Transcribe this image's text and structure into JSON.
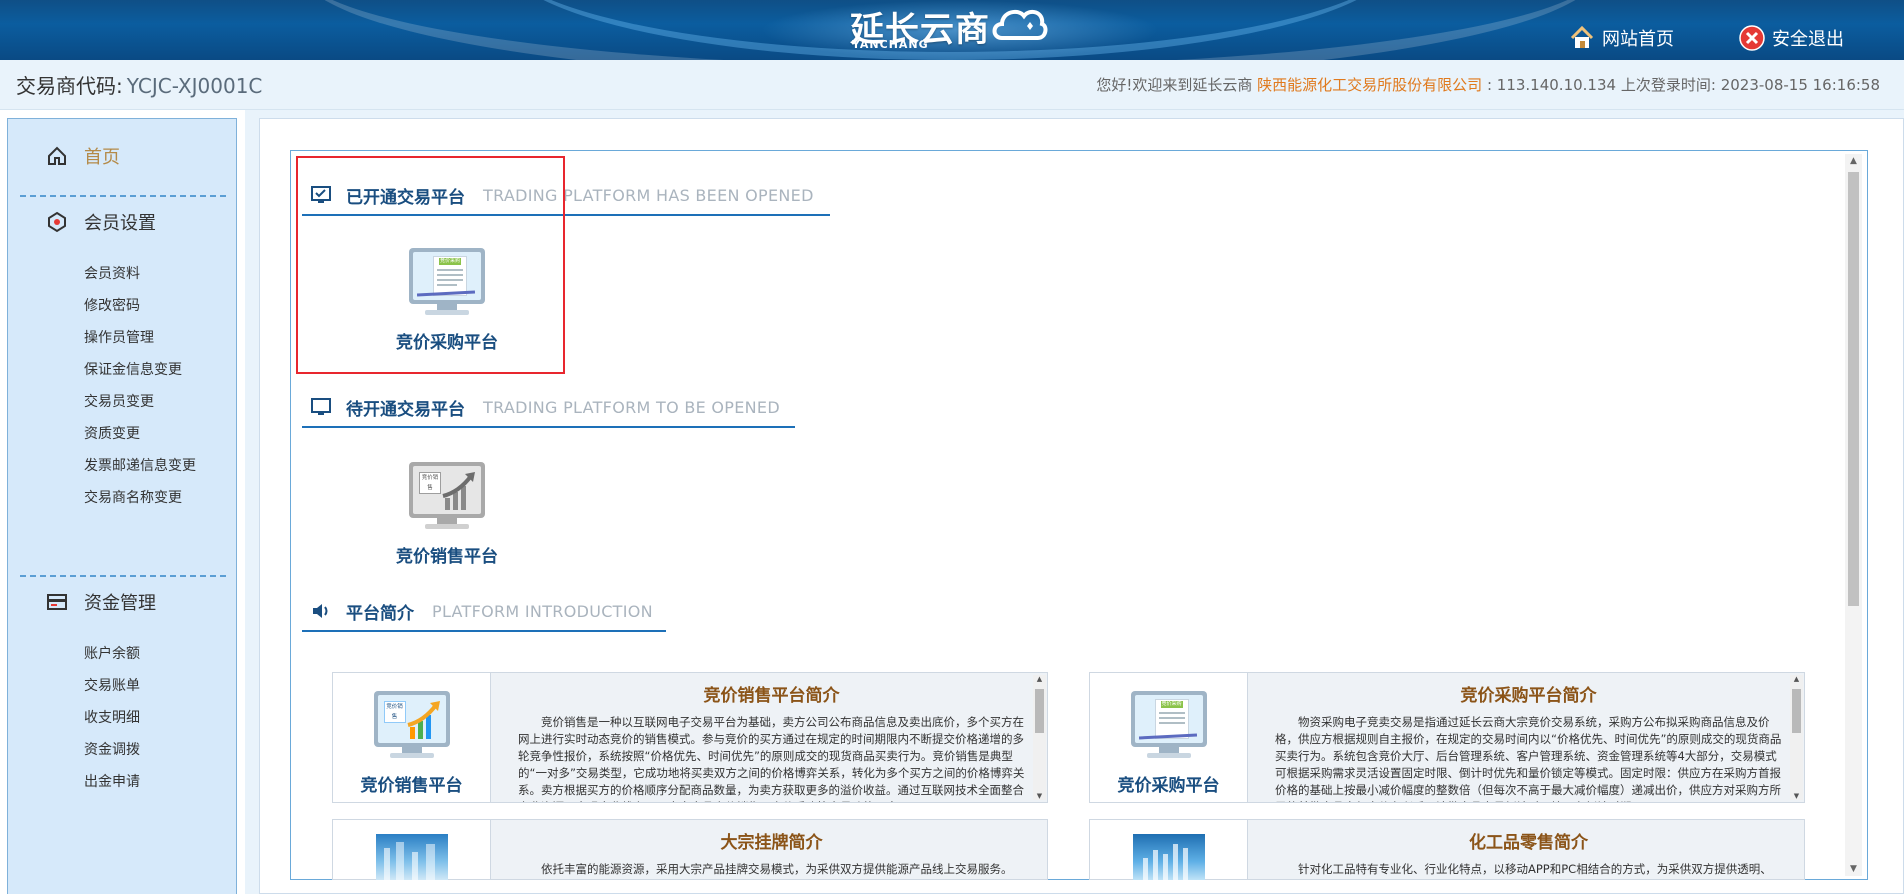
{
  "header": {
    "logo_cn": "延长云商",
    "logo_en": "YANCHANG",
    "home_label": "网站首页",
    "logout_label": "安全退出"
  },
  "infobar": {
    "trader_label": "交易商代码:",
    "trader_code": "YCJC-XJ0001C",
    "welcome_prefix": "您好!欢迎来到延长云商",
    "company": "陕西能源化工交易所股份有限公司",
    "ip_text": ": 113.140.10.134",
    "last_login_label": "上次登录时间:",
    "last_login_time": "2023-08-15 16:16:58"
  },
  "sidebar": {
    "home": "首页",
    "member_settings": {
      "title": "会员设置",
      "items": [
        "会员资料",
        "修改密码",
        "操作员管理",
        "保证金信息变更",
        "交易员变更",
        "资质变更",
        "发票邮递信息变更",
        "交易商名称变更"
      ]
    },
    "fund_management": {
      "title": "资金管理",
      "items": [
        "账户余额",
        "交易账单",
        "收支明细",
        "资金调拨",
        "出金申请"
      ]
    }
  },
  "main": {
    "opened": {
      "title_cn": "已开通交易平台",
      "title_en": "TRADING PLATFORM HAS BEEN OPENED",
      "platforms": [
        {
          "name": "竞价采购平台",
          "icon_text": "竞价采购"
        }
      ]
    },
    "to_open": {
      "title_cn": "待开通交易平台",
      "title_en": "TRADING PLATFORM TO BE OPENED",
      "platforms": [
        {
          "name": "竞价销售平台",
          "icon_text": "竞价销售"
        }
      ]
    },
    "intro": {
      "title_cn": "平台简介",
      "title_en": "PLATFORM INTRODUCTION",
      "cards": [
        {
          "caption": "竞价销售平台",
          "icon_text": "竞价销售",
          "title": "竞价销售平台简介",
          "text": "竞价销售是一种以互联网电子交易平台为基础，卖方公司公布商品信息及卖出底价，多个买方在网上进行实时动态竞价的销售模式。参与竞价的买方通过在规定的时间期限内不断提交价格递增的多轮竞争性报价，系统按照“价格优先、时间优先”的原则成交的现货商品买卖行为。竞价销售是典型的“一对多”交易类型，它成功地将买卖双方之间的价格博弈关系，转化为多个买方之间的价格博弈关系。卖方根据买方的价格顺序分配商品数量，为卖方获取更多的溢价收益。通过互联网技术全面整合产业资源，实现企业线上B2B大宗商品竞价销售、竞价采购等交易功能，赛"
        },
        {
          "caption": "竞价采购平台",
          "icon_text": "竞价采购",
          "title": "竞价采购平台简介",
          "text": "物资采购电子竞卖交易是指通过延长云商大宗竞价交易系统，采购方公布拟采购商品信息及价格，供应方根据规则自主报价，在规定的交易时间内以“价格优先、时间优先”的原则成交的现货商品买卖行为。系统包含竞价大厅、后台管理系统、客户管理系统、资金管理系统等4大部分，交易模式可根据采购需求灵活设置固定时限、倒计时优先和量价锁定等模式。固定时限：供应方在采购方首报价格的基础上按最小减价幅度的整数倍（但每次不高于最大减价幅度）递减出价，供应方对采购方所需的某批商品全部出价有兴后，该批商品交易倒计时开始，在倒计时期"
        },
        {
          "caption": "",
          "title": "大宗挂牌简介",
          "text": "依托丰富的能源资源，采用大宗产品挂牌交易模式，为采供双方提供能源产品线上交易服务。"
        },
        {
          "caption": "",
          "title": "化工品零售简介",
          "text": "针对化工品特有专业化、行业化特点，以移动APP和PC相结合的方式，为采供双方提供透明、"
        }
      ]
    }
  },
  "colors": {
    "header_blue": "#0b5d9f",
    "title_blue": "#1a4e80",
    "company_orange": "#e07a1e",
    "highlight_red": "#e8262e",
    "intro_title_brown": "#8b5418"
  }
}
